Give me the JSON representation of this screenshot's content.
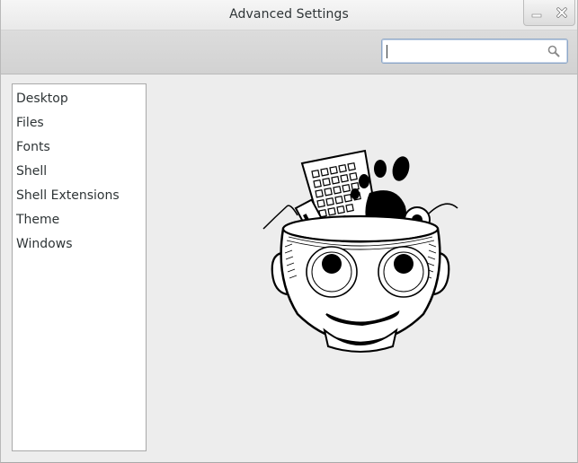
{
  "window": {
    "title": "Advanced Settings"
  },
  "search": {
    "value": "",
    "placeholder": "",
    "icon": "search-icon"
  },
  "sidebar": {
    "items": [
      {
        "label": "Desktop"
      },
      {
        "label": "Files"
      },
      {
        "label": "Fonts"
      },
      {
        "label": "Shell"
      },
      {
        "label": "Shell Extensions"
      },
      {
        "label": "Theme"
      },
      {
        "label": "Windows"
      }
    ]
  },
  "colors": {
    "background": "#ededed",
    "search_border": "#8ea7c7",
    "text": "#2e3436"
  }
}
